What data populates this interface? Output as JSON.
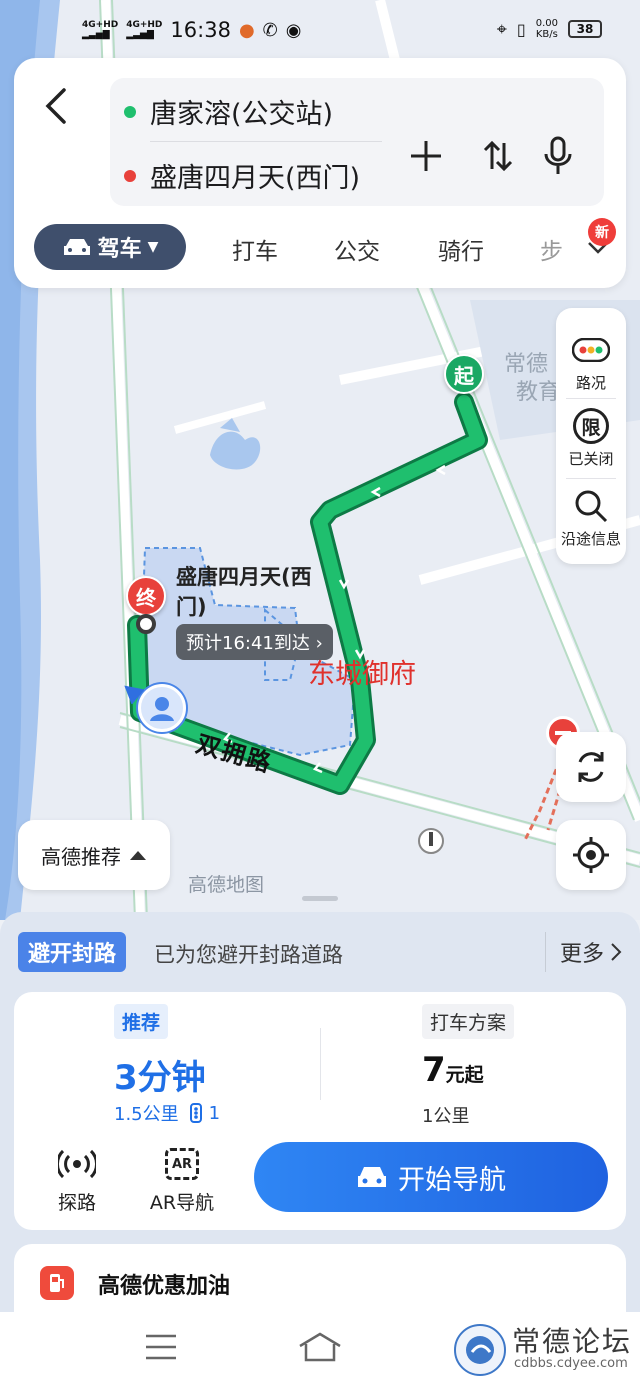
{
  "status_bar": {
    "signal_1": "4G+HD",
    "signal_2": "4G+HD",
    "time": "16:38",
    "net_speed_value": "0.00",
    "net_speed_unit": "KB/s",
    "battery": "38"
  },
  "route": {
    "origin": "唐家溶(公交站)",
    "destination": "盛唐四月天(西门)"
  },
  "tabs": {
    "active": "驾车",
    "items": [
      "打车",
      "公交",
      "骑行",
      "步"
    ],
    "new_badge": "新"
  },
  "map": {
    "start_pin": "起",
    "end_pin": "终",
    "destination_label": "盛唐四月天(西门)",
    "eta": "预计16:41到达",
    "poi_label": "东城御府",
    "road_label": "双拥路",
    "area_label": "常德",
    "area_label_2": "教育",
    "watermark": "高德地图"
  },
  "right_tools": {
    "traffic": "路况",
    "restriction": "已关闭",
    "restriction_glyph": "限",
    "along_route": "沿途信息"
  },
  "recommend_chip": "高德推荐",
  "notice": {
    "tag": "避开封路",
    "text": "已为您避开封路道路",
    "more": "更多"
  },
  "plan": {
    "tag": "推荐",
    "time": "3分钟",
    "distance": "1.5公里",
    "lights": "1"
  },
  "taxi": {
    "tag": "打车方案",
    "price": "7",
    "price_suffix": "元起",
    "distance": "1公里"
  },
  "actions": {
    "explore": "探路",
    "ar": "AR导航",
    "ar_glyph": "AR",
    "start_nav": "开始导航"
  },
  "fuel": "高德优惠加油",
  "forum": {
    "name": "常德论坛",
    "url": "cdbbs.cdyee.com"
  },
  "colors": {
    "route_green": "#1aa864",
    "accent_blue": "#1f6fe6",
    "tab_active": "#3f4f6c",
    "end_red": "#e8413b",
    "area_fill": "#c9d8f2"
  }
}
